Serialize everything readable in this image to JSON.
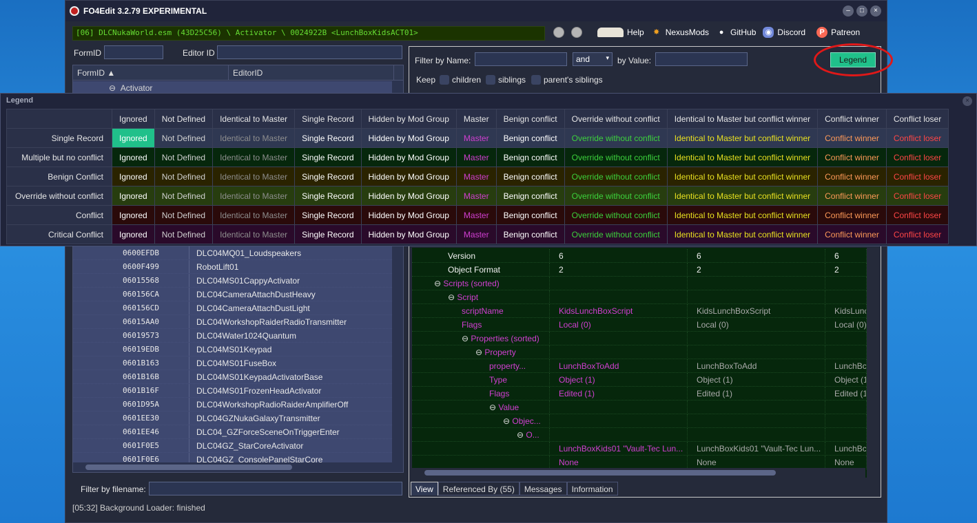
{
  "window": {
    "title": "FO4Edit 3.2.79 EXPERIMENTAL",
    "path": "[06] DLCNukaWorld.esm (43D25C56) \\ Activator \\ 0024922B <LunchBoxKidsACT01>",
    "buttons": {
      "minimize": "–",
      "maximize": "□",
      "close": "×"
    }
  },
  "toolbar": {
    "items": [
      {
        "label": "Help",
        "icon": "book-icon"
      },
      {
        "label": "NexusMods",
        "icon": "nexusmods-icon"
      },
      {
        "label": "GitHub",
        "icon": "github-icon"
      },
      {
        "label": "Discord",
        "icon": "discord-icon"
      },
      {
        "label": "Patreon",
        "icon": "patreon-icon"
      }
    ]
  },
  "left": {
    "formid_label": "FormID",
    "editorid_label": "Editor ID",
    "col_formid": "FormID",
    "col_editorid": "EditorID",
    "tree_node": "Activator",
    "rows": [
      {
        "fid": "0600EFDB",
        "eid": "DLC04MQ01_Loudspeakers"
      },
      {
        "fid": "0600F499",
        "eid": "RobotLift01"
      },
      {
        "fid": "06015568",
        "eid": "DLC04MS01CappyActivator"
      },
      {
        "fid": "060156CA",
        "eid": "DLC04CameraAttachDustHeavy"
      },
      {
        "fid": "060156CD",
        "eid": "DLC04CameraAttachDustLight"
      },
      {
        "fid": "06015AA0",
        "eid": "DLC04WorkshopRaiderRadioTransmitter"
      },
      {
        "fid": "06019573",
        "eid": "DLC04Water1024Quantum"
      },
      {
        "fid": "06019EDB",
        "eid": "DLC04MS01Keypad"
      },
      {
        "fid": "0601B163",
        "eid": "DLC04MS01FuseBox"
      },
      {
        "fid": "0601B16B",
        "eid": "DLC04MS01KeypadActivatorBase"
      },
      {
        "fid": "0601B16F",
        "eid": "DLC04MS01FrozenHeadActivator"
      },
      {
        "fid": "0601D95A",
        "eid": "DLC04WorkshopRadioRaiderAmplifierOff"
      },
      {
        "fid": "0601EE30",
        "eid": "DLC04GZNukaGalaxyTransmitter"
      },
      {
        "fid": "0601EE46",
        "eid": "DLC04_GZForceSceneOnTriggerEnter"
      },
      {
        "fid": "0601F0E5",
        "eid": "DLC04GZ_StarCoreActivator"
      },
      {
        "fid": "0601F0E6",
        "eid": "DLC04GZ_ConsolePanelStarCore"
      }
    ],
    "filter_filename_label": "Filter by filename:"
  },
  "filter": {
    "by_name_label": "Filter by Name:",
    "operator": "and",
    "by_value_label": "by Value:",
    "keep_label": "Keep",
    "children_label": "children",
    "siblings_label": "siblings",
    "parents_siblings_label": "parent's siblings",
    "legend_button": "Legend"
  },
  "detail": {
    "rows": [
      {
        "name": "Version",
        "v1": "6",
        "v2": "6",
        "v3": "6",
        "color": "white"
      },
      {
        "name": "Object Format",
        "v1": "2",
        "v2": "2",
        "v3": "2",
        "color": "white"
      },
      {
        "name": "Scripts (sorted)",
        "v1": "",
        "v2": "",
        "v3": "",
        "color": "magenta"
      },
      {
        "name": "Script",
        "v1": "",
        "v2": "",
        "v3": "",
        "color": "magenta"
      },
      {
        "name": "scriptName",
        "v1": "KidsLunchBoxScript",
        "v2": "KidsLunchBoxScript",
        "v3": "KidsLunc",
        "color": "magenta"
      },
      {
        "name": "Flags",
        "v1": "Local (0)",
        "v2": "Local (0)",
        "v3": "Local (0)",
        "color": "magenta"
      },
      {
        "name": "Properties (sorted)",
        "v1": "",
        "v2": "",
        "v3": "",
        "color": "magenta"
      },
      {
        "name": "Property",
        "v1": "",
        "v2": "",
        "v3": "",
        "color": "magenta"
      },
      {
        "name": "property...",
        "v1": "LunchBoxToAdd",
        "v2": "LunchBoxToAdd",
        "v3": "LunchBc",
        "color": "magenta"
      },
      {
        "name": "Type",
        "v1": "Object (1)",
        "v2": "Object (1)",
        "v3": "Object (1",
        "color": "magenta"
      },
      {
        "name": "Flags",
        "v1": "Edited (1)",
        "v2": "Edited (1)",
        "v3": "Edited (1",
        "color": "magenta"
      },
      {
        "name": "Value",
        "v1": "",
        "v2": "",
        "v3": "",
        "color": "magenta"
      },
      {
        "name": "Objec...",
        "v1": "",
        "v2": "",
        "v3": "",
        "color": "magenta"
      },
      {
        "name": "O...",
        "v1": "",
        "v2": "",
        "v3": "",
        "color": "magenta"
      },
      {
        "name": "",
        "v1": "LunchBoxKids01 \"Vault-Tec Lun...",
        "v2": "LunchBoxKids01 \"Vault-Tec Lun...",
        "v3": "LunchBc",
        "color": "magenta"
      },
      {
        "name": "",
        "v1": "None",
        "v2": "None",
        "v3": "None",
        "color": "magenta"
      }
    ]
  },
  "tabs": [
    "View",
    "Referenced By (55)",
    "Messages",
    "Information"
  ],
  "status": "[05:32] Background Loader: finished",
  "legend": {
    "title": "Legend",
    "columns": [
      "Ignored",
      "Not Defined",
      "Identical to Master",
      "Single Record",
      "Hidden by Mod Group",
      "Master",
      "Benign conflict",
      "Override without conflict",
      "Identical to Master but conflict winner",
      "Conflict winner",
      "Conflict loser"
    ],
    "rows": [
      "Single Record",
      "Multiple but no conflict",
      "Benign Conflict",
      "Override without conflict",
      "Conflict",
      "Critical Conflict"
    ],
    "row_bg": [
      "#2f3852",
      "#06270c",
      "#2a2300",
      "#273d0f",
      "#2a0a0a",
      "#2a0a2a"
    ],
    "fg": [
      "#ffffff",
      "#d0d0d0",
      "#8e8e8e",
      "#ffffff",
      "#ffffff",
      "#d23fd2",
      "#ffffff",
      "#3cd23c",
      "#e8e020",
      "#ff9a58",
      "#ff4646"
    ],
    "highlight_bg": "#20c08a"
  }
}
